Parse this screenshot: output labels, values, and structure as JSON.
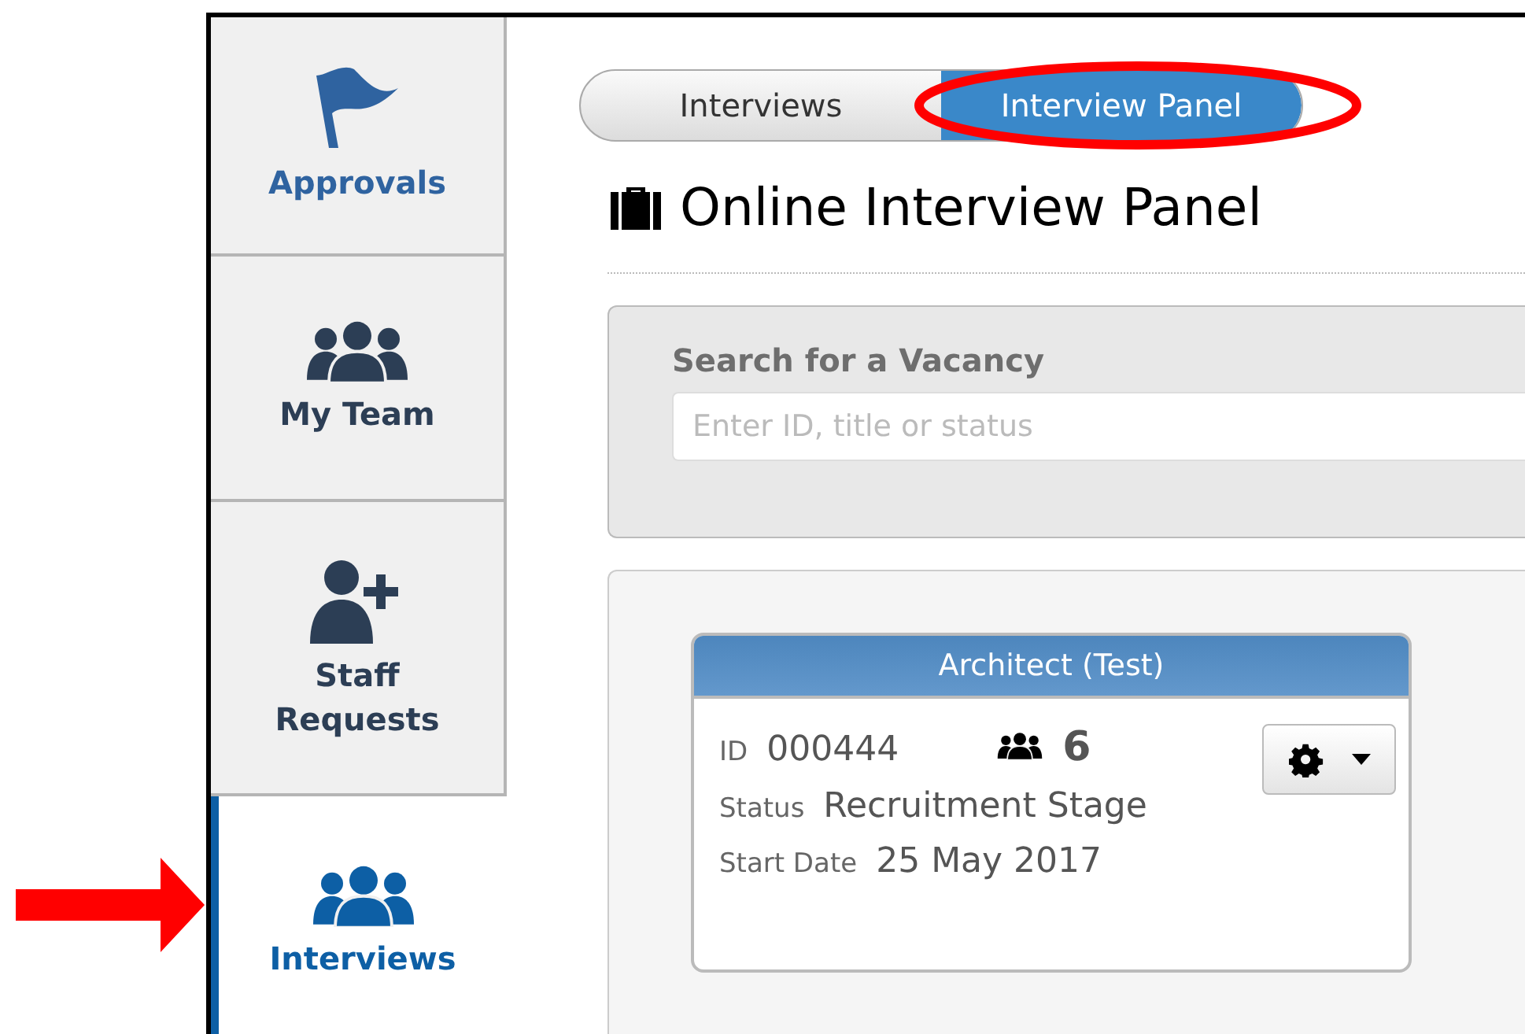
{
  "sidebar": {
    "items": [
      {
        "label": "Approvals",
        "highlighted": true,
        "selected": false
      },
      {
        "label": "My Team",
        "highlighted": false,
        "selected": false
      },
      {
        "label": "Staff Requests",
        "highlighted": false,
        "selected": false
      },
      {
        "label": "Interviews",
        "highlighted": false,
        "selected": true
      }
    ]
  },
  "tabs": [
    {
      "label": "Interviews",
      "selected": false
    },
    {
      "label": "Interview Panel",
      "selected": true
    }
  ],
  "page_title": "Online Interview Panel",
  "search": {
    "label": "Search for a Vacancy",
    "placeholder": "Enter ID, title or status"
  },
  "vacancy": {
    "title": "Architect (Test)",
    "id_label": "ID",
    "id": "000444",
    "member_count": "6",
    "status_label": "Status",
    "status": "Recruitment Stage",
    "start_label": "Start Date",
    "start_date": "25 May 2017"
  },
  "annotations": {
    "ellipse_on_tab": true,
    "arrow_to_item": true
  }
}
